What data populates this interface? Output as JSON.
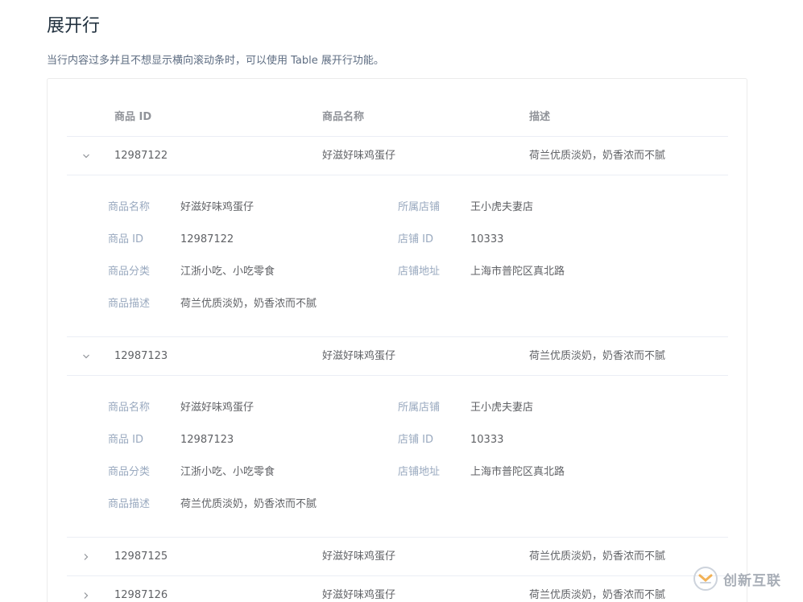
{
  "page": {
    "title": "展开行",
    "description": "当行内容过多并且不想显示横向滚动条时，可以使用 Table 展开行功能。"
  },
  "table": {
    "columns": [
      "商品 ID",
      "商品名称",
      "描述"
    ],
    "detail_labels": {
      "name": "商品名称",
      "shop": "所属店铺",
      "id": "商品 ID",
      "shop_id": "店铺 ID",
      "category": "商品分类",
      "address": "店铺地址",
      "desc": "商品描述"
    },
    "rows": [
      {
        "id": "12987122",
        "name": "好滋好味鸡蛋仔",
        "desc": "荷兰优质淡奶，奶香浓而不腻",
        "expanded": true,
        "detail": {
          "name": "好滋好味鸡蛋仔",
          "shop": "王小虎夫妻店",
          "id": "12987122",
          "shop_id": "10333",
          "category": "江浙小吃、小吃零食",
          "address": "上海市普陀区真北路",
          "desc": "荷兰优质淡奶，奶香浓而不腻"
        }
      },
      {
        "id": "12987123",
        "name": "好滋好味鸡蛋仔",
        "desc": "荷兰优质淡奶，奶香浓而不腻",
        "expanded": true,
        "detail": {
          "name": "好滋好味鸡蛋仔",
          "shop": "王小虎夫妻店",
          "id": "12987123",
          "shop_id": "10333",
          "category": "江浙小吃、小吃零食",
          "address": "上海市普陀区真北路",
          "desc": "荷兰优质淡奶，奶香浓而不腻"
        }
      },
      {
        "id": "12987125",
        "name": "好滋好味鸡蛋仔",
        "desc": "荷兰优质淡奶，奶香浓而不腻",
        "expanded": false
      },
      {
        "id": "12987126",
        "name": "好滋好味鸡蛋仔",
        "desc": "荷兰优质淡奶，奶香浓而不腻",
        "expanded": false
      }
    ]
  },
  "icons": {
    "expanded": "chevron-down-icon",
    "collapsed": "chevron-right-icon"
  },
  "watermark": {
    "text": "创新互联"
  },
  "colors": {
    "title": "#1f2f3d",
    "text": "#606266",
    "header": "#909399",
    "label": "#99a9bf",
    "border": "#ebeef5"
  }
}
